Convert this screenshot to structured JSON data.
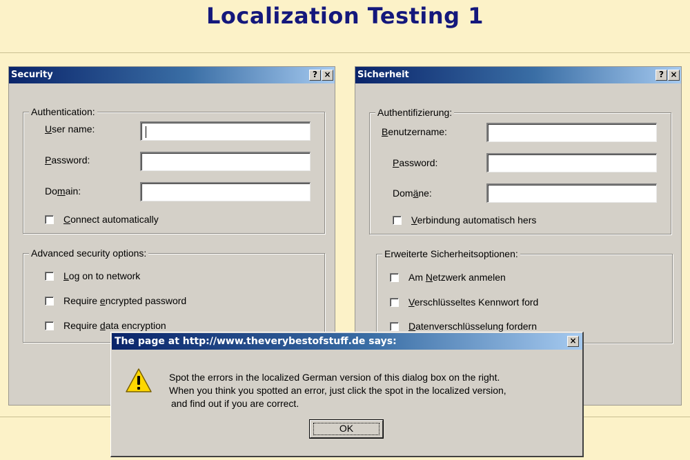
{
  "page_title": "Localization Testing 1",
  "left_dialog": {
    "title": "Security",
    "help_button": "?",
    "close_button": "×",
    "auth_group": "Authentication:",
    "username": {
      "ul": "U",
      "rest": "ser name:"
    },
    "password": {
      "ul": "P",
      "rest": "assword:"
    },
    "domain": {
      "pre": "Do",
      "ul": "m",
      "rest": "ain:"
    },
    "connect_auto": {
      "ul": "C",
      "rest": "onnect automatically"
    },
    "adv_group": "Advanced security options:",
    "logon": {
      "ul": "L",
      "rest": "og on to network"
    },
    "encrypted_pw": {
      "pre": "Require ",
      "ul": "e",
      "rest": "ncrypted password"
    },
    "data_encryption": {
      "pre": "Require ",
      "ul": "d",
      "rest": "ata encryption"
    }
  },
  "right_dialog": {
    "title": "Sicherheit",
    "help_button": "?",
    "close_button": "×",
    "auth_group": "Authentifizierung:",
    "username": {
      "ul": "B",
      "rest": "enutzername:"
    },
    "password": {
      "ul": "P",
      "rest": "assword:"
    },
    "domain": {
      "pre": "Dom",
      "ul": "ä",
      "rest": "ne:"
    },
    "connect_auto": {
      "ul": "V",
      "rest": "erbindung automatisch hers"
    },
    "adv_group": "Erweiterte Sicherheitsoptionen:",
    "logon": {
      "pre": "Am ",
      "ul": "N",
      "rest": "etzwerk anmelen"
    },
    "encrypted_pw": {
      "ul": "V",
      "rest": "erschlüsseltes Kennwort ford"
    },
    "data_encryption": {
      "ul": "D",
      "rest": "atenverschlüsselung fordern"
    }
  },
  "alert": {
    "title": "The page at http://www.theverybestofstuff.de says:",
    "close_button": "×",
    "line1": "Spot the errors in the localized German version of this dialog box on the right.",
    "line2": "When you think you spotted an error, just click the spot in the localized version,",
    "line3": "and find out if you are correct.",
    "ok": "OK",
    "icon": "warning-icon"
  },
  "colors": {
    "page_bg": "#fcf2c8",
    "title_text": "#14187c",
    "titlebar_start": "#0a246a",
    "titlebar_end": "#a6caf0",
    "dialog_face": "#d4d0c8"
  }
}
